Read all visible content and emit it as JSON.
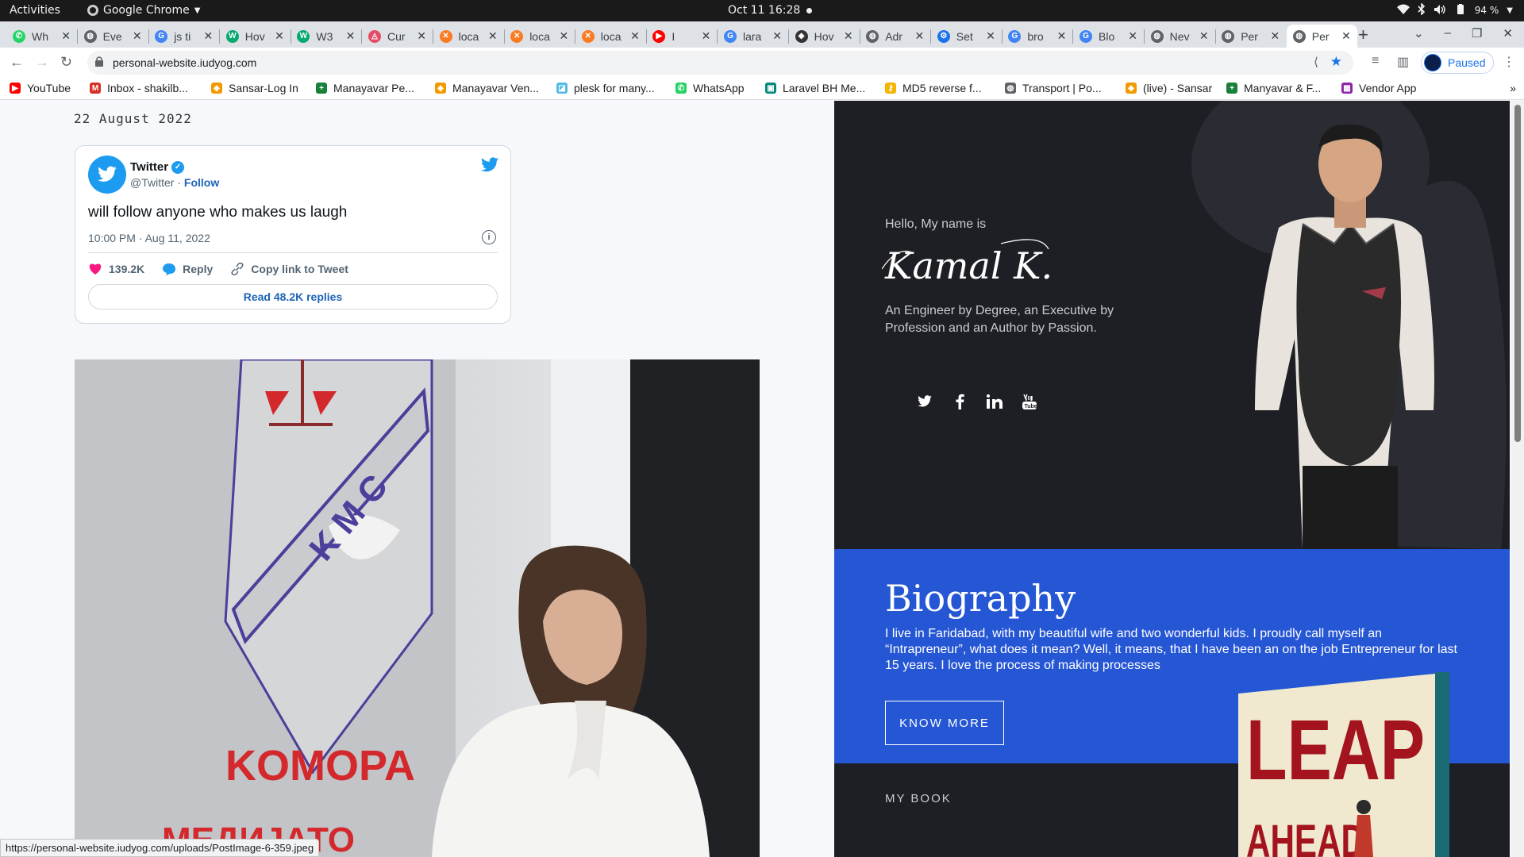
{
  "system": {
    "activities": "Activities",
    "app_name": "Google Chrome",
    "clock": "Oct 11  16:28",
    "battery": "94 %"
  },
  "tabs": [
    {
      "title": "Wh",
      "icon": "whatsapp-icon",
      "color": "#25d366"
    },
    {
      "title": "Eve",
      "icon": "globe-icon",
      "color": "#5f6368"
    },
    {
      "title": "js ti",
      "icon": "google-icon",
      "color": "#4285f4"
    },
    {
      "title": "Hov",
      "icon": "w3schools-icon",
      "color": "#04aa6d"
    },
    {
      "title": "W3",
      "icon": "w3schools-icon",
      "color": "#04aa6d"
    },
    {
      "title": "Cur",
      "icon": "cur-icon",
      "color": "#e44c65"
    },
    {
      "title": "loca",
      "icon": "xampp-icon",
      "color": "#fb7a24"
    },
    {
      "title": "loca",
      "icon": "xampp-icon",
      "color": "#fb7a24"
    },
    {
      "title": "loca",
      "icon": "xampp-icon",
      "color": "#fb7a24"
    },
    {
      "title": "I",
      "icon": "youtube-icon",
      "color": "#ff0000"
    },
    {
      "title": "lara",
      "icon": "google-icon",
      "color": "#4285f4"
    },
    {
      "title": "Hov",
      "icon": "hov-icon",
      "color": "#333333"
    },
    {
      "title": "Adr",
      "icon": "globe-icon",
      "color": "#5f6368"
    },
    {
      "title": "Set",
      "icon": "gear-icon",
      "color": "#1a73e8"
    },
    {
      "title": "bro",
      "icon": "google-icon",
      "color": "#4285f4"
    },
    {
      "title": "Blo",
      "icon": "google-icon",
      "color": "#4285f4"
    },
    {
      "title": "Nev",
      "icon": "globe-icon",
      "color": "#5f6368"
    },
    {
      "title": "Per",
      "icon": "globe-icon",
      "color": "#5f6368"
    },
    {
      "title": "Per",
      "icon": "globe-icon",
      "color": "#5f6368",
      "active": true
    }
  ],
  "toolbar": {
    "url": "personal-website.iudyog.com",
    "profile_label": "Paused"
  },
  "bookmarks": [
    {
      "label": "YouTube",
      "icon": "youtube-icon",
      "color": "#ff0000"
    },
    {
      "label": "Inbox - shakilb...",
      "icon": "gmail-icon",
      "color": "#d93025"
    },
    {
      "label": "Sansar-Log In",
      "icon": "shield-icon",
      "color": "#f29900"
    },
    {
      "label": "Manayavar Pe...",
      "icon": "sheets-icon",
      "color": "#188038"
    },
    {
      "label": "Manayavar Ven...",
      "icon": "shield-icon",
      "color": "#f29900"
    },
    {
      "label": "plesk for many...",
      "icon": "plesk-icon",
      "color": "#52bbe6"
    },
    {
      "label": "WhatsApp",
      "icon": "whatsapp-icon",
      "color": "#25d366"
    },
    {
      "label": "Laravel BH Me...",
      "icon": "meet-icon",
      "color": "#00897b"
    },
    {
      "label": "MD5 reverse f...",
      "icon": "key-icon",
      "color": "#f4b400"
    },
    {
      "label": "Transport | Po...",
      "icon": "globe-icon",
      "color": "#5f6368"
    },
    {
      "label": "(live) - Sansar",
      "icon": "shield-icon",
      "color": "#f29900"
    },
    {
      "label": "Manyavar & F...",
      "icon": "sheets-icon",
      "color": "#188038"
    },
    {
      "label": "Vendor App",
      "icon": "calendar-icon",
      "color": "#8e24aa"
    }
  ],
  "post": {
    "date": "22 August 2022"
  },
  "tweet": {
    "name": "Twitter",
    "handle": "@Twitter",
    "separator": " · ",
    "follow": "Follow",
    "text": "will follow anyone who makes us laugh",
    "time": "10:00 PM · Aug 11, 2022",
    "likes": "139.2K",
    "reply": "Reply",
    "copy_link": "Copy link to Tweet",
    "read_replies": "Read 48.2K replies"
  },
  "image_sign": {
    "initials": "K M C",
    "word": "KOMOPA",
    "word2": "МЕДИЈАТО"
  },
  "hero": {
    "hello": "Hello, My name is",
    "signature": "Kamal K.",
    "tagline": "An Engineer by Degree, an Executive by Profession and an Author by Passion."
  },
  "social": [
    "twitter-icon",
    "facebook-icon",
    "linkedin-icon",
    "youtube-icon"
  ],
  "bio": {
    "heading": "Biography",
    "body": "I live in Faridabad, with my beautiful wife and two wonderful kids. I proudly call myself an “Intrapreneur”, what does it mean? Well, it means, that I have been an on the job Entrepreneur for last 15 years. I love the process of making processes",
    "button": "KNOW MORE"
  },
  "book": {
    "section_label": "MY BOOK",
    "title_line1": "LEAP",
    "title_line2": "AHEAD"
  },
  "status_url": "https://personal-website.iudyog.com/uploads/PostImage-6-359.jpeg"
}
